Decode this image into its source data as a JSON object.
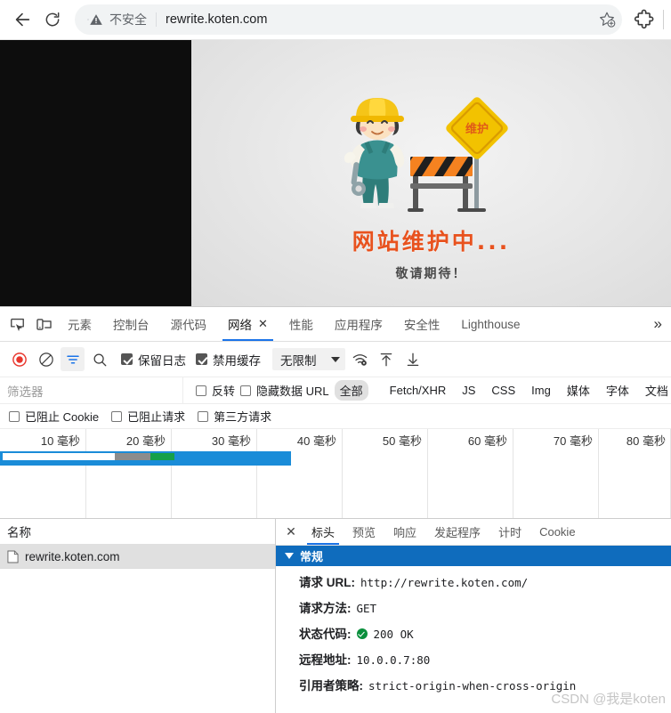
{
  "browser": {
    "back_tooltip": "后退",
    "reload_tooltip": "重新加载",
    "security_label": "不安全",
    "url": "rewrite.koten.com",
    "bookmark_tooltip": "添加书签",
    "extensions_tooltip": "扩展程序"
  },
  "page": {
    "maintenance_title": "网站维护中...",
    "maintenance_subtitle": "敬请期待！",
    "sign_text": "维护"
  },
  "devtools": {
    "tabs": [
      {
        "label": "元素",
        "active": false,
        "closable": false
      },
      {
        "label": "控制台",
        "active": false,
        "closable": false
      },
      {
        "label": "源代码",
        "active": false,
        "closable": false
      },
      {
        "label": "网络",
        "active": true,
        "closable": true
      },
      {
        "label": "性能",
        "active": false,
        "closable": false
      },
      {
        "label": "应用程序",
        "active": false,
        "closable": false
      },
      {
        "label": "安全性",
        "active": false,
        "closable": false
      },
      {
        "label": "Lighthouse",
        "active": false,
        "closable": false
      }
    ],
    "close_glyph": "✕",
    "overflow_glyph": "»",
    "inspect_icon": "inspect-element-icon",
    "device_icon": "device-toggle-icon"
  },
  "network_toolbar": {
    "record_tooltip": "停止记录网络日志",
    "clear_tooltip": "清除",
    "filter_tooltip": "过滤",
    "search_tooltip": "搜索",
    "preserve_log_label": "保留日志",
    "preserve_log_checked": true,
    "disable_cache_label": "禁用缓存",
    "disable_cache_checked": true,
    "throttle_value": "无限制",
    "network_conditions_tooltip": "网络状况",
    "import_tooltip": "导入 HAR 文件",
    "export_tooltip": "导出 HAR 文件"
  },
  "filter_bar": {
    "placeholder": "筛选器",
    "invert_label": "反转",
    "invert_checked": false,
    "hide_data_urls_label": "隐藏数据 URL",
    "hide_data_urls_checked": false,
    "types": [
      {
        "label": "全部",
        "selected": true
      },
      {
        "label": "Fetch/XHR",
        "selected": false
      },
      {
        "label": "JS",
        "selected": false
      },
      {
        "label": "CSS",
        "selected": false
      },
      {
        "label": "Img",
        "selected": false
      },
      {
        "label": "媒体",
        "selected": false
      },
      {
        "label": "字体",
        "selected": false
      },
      {
        "label": "文档",
        "selected": false
      }
    ]
  },
  "cookie_bar": {
    "blocked_cookies_label": "已阻止 Cookie",
    "blocked_cookies_checked": false,
    "blocked_requests_label": "已阻止请求",
    "blocked_requests_checked": false,
    "third_party_label": "第三方请求",
    "third_party_checked": false
  },
  "overview": {
    "ticks": [
      "10 毫秒",
      "20 毫秒",
      "30 毫秒",
      "40 毫秒",
      "50 毫秒",
      "60 毫秒",
      "70 毫秒",
      "80 毫秒"
    ],
    "unit": "毫秒",
    "bar_colors": {
      "total": "#1a8cd8",
      "waiting": "#8c8c8c",
      "download": "#15a04a",
      "idle": "#ffffff"
    }
  },
  "request_list": {
    "column_header": "名称",
    "rows": [
      {
        "name": "rewrite.koten.com",
        "icon": "document-icon",
        "selected": true
      }
    ]
  },
  "detail_panel": {
    "close_glyph": "✕",
    "tabs": [
      {
        "label": "标头",
        "active": true
      },
      {
        "label": "预览",
        "active": false
      },
      {
        "label": "响应",
        "active": false
      },
      {
        "label": "发起程序",
        "active": false
      },
      {
        "label": "计时",
        "active": false
      },
      {
        "label": "Cookie",
        "active": false
      }
    ],
    "section_title": "常规",
    "fields": [
      {
        "key": "请求 URL:",
        "value": "http://rewrite.koten.com/",
        "status": false
      },
      {
        "key": "请求方法:",
        "value": "GET",
        "status": false
      },
      {
        "key": "状态代码:",
        "value": "200 OK",
        "status": true
      },
      {
        "key": "远程地址:",
        "value": "10.0.0.7:80",
        "status": false
      },
      {
        "key": "引用者策略:",
        "value": "strict-origin-when-cross-origin",
        "status": false
      }
    ]
  },
  "watermark": "CSDN @我是koten"
}
